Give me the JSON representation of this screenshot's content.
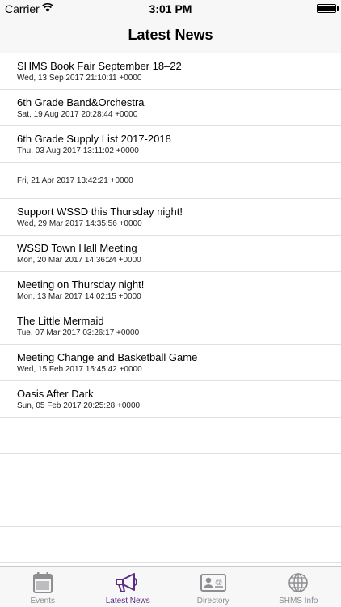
{
  "status_bar": {
    "carrier": "Carrier",
    "time": "3:01 PM"
  },
  "nav": {
    "title": "Latest News"
  },
  "news": [
    {
      "title": "SHMS Book Fair September 18–22",
      "date": "Wed, 13 Sep 2017 21:10:11 +0000"
    },
    {
      "title": "6th Grade Band&Orchestra",
      "date": "Sat, 19 Aug 2017 20:28:44 +0000"
    },
    {
      "title": "6th Grade Supply List 2017-2018",
      "date": "Thu, 03 Aug 2017 13:11:02 +0000"
    },
    {
      "title": "",
      "date": "Fri, 21 Apr 2017 13:42:21 +0000"
    },
    {
      "title": "Support WSSD this Thursday night!",
      "date": "Wed, 29 Mar 2017 14:35:56 +0000"
    },
    {
      "title": "WSSD Town Hall Meeting",
      "date": "Mon, 20 Mar 2017 14:36:24 +0000"
    },
    {
      "title": "Meeting on Thursday night!",
      "date": "Mon, 13 Mar 2017 14:02:15 +0000"
    },
    {
      "title": "The Little Mermaid",
      "date": "Tue, 07 Mar 2017 03:26:17 +0000"
    },
    {
      "title": "Meeting Change and Basketball Game",
      "date": "Wed, 15 Feb 2017 15:45:42 +0000"
    },
    {
      "title": "Oasis After Dark",
      "date": "Sun, 05 Feb 2017 20:25:28 +0000"
    }
  ],
  "tabs": [
    {
      "label": "Events",
      "icon": "calendar-icon",
      "active": false
    },
    {
      "label": "Latest News",
      "icon": "megaphone-icon",
      "active": true
    },
    {
      "label": "Directory",
      "icon": "contact-card-icon",
      "active": false
    },
    {
      "label": "SHMS Info",
      "icon": "globe-icon",
      "active": false
    }
  ],
  "colors": {
    "accent": "#5b2d86",
    "inactive_tab": "#8e8e93",
    "bar_background": "#f7f7f7",
    "separator": "#e0e0e0"
  }
}
